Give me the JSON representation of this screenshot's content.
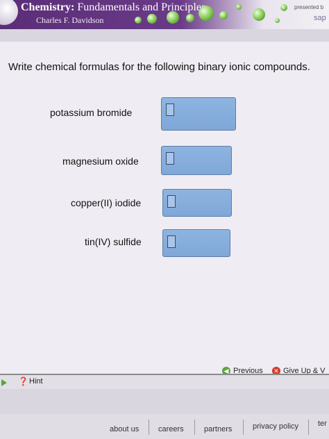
{
  "header": {
    "title_bold": "Chemistry:",
    "title_rest": " Fundamentals and Principles",
    "author": "Charles F. Davidson",
    "presented_by": "presented b",
    "sponsor": "sap"
  },
  "question": {
    "instructions": "Write chemical formulas for the following binary ionic compounds.",
    "items": [
      {
        "label": "potassium bromide",
        "answer": ""
      },
      {
        "label": "magnesium oxide",
        "answer": ""
      },
      {
        "label": "copper(II) iodide",
        "answer": ""
      },
      {
        "label": "tin(IV) sulfide",
        "answer": ""
      }
    ]
  },
  "controls": {
    "previous": "Previous",
    "give_up": "Give Up & V",
    "hint": "Hint"
  },
  "footer": {
    "links": [
      "about us",
      "careers",
      "partners",
      "privacy policy",
      "ter"
    ]
  },
  "colors": {
    "header_purple": "#5b2d77",
    "answer_box_blue": "#8eb4e0",
    "accent_green": "#5aa53a",
    "give_up_red": "#d23a2b"
  }
}
